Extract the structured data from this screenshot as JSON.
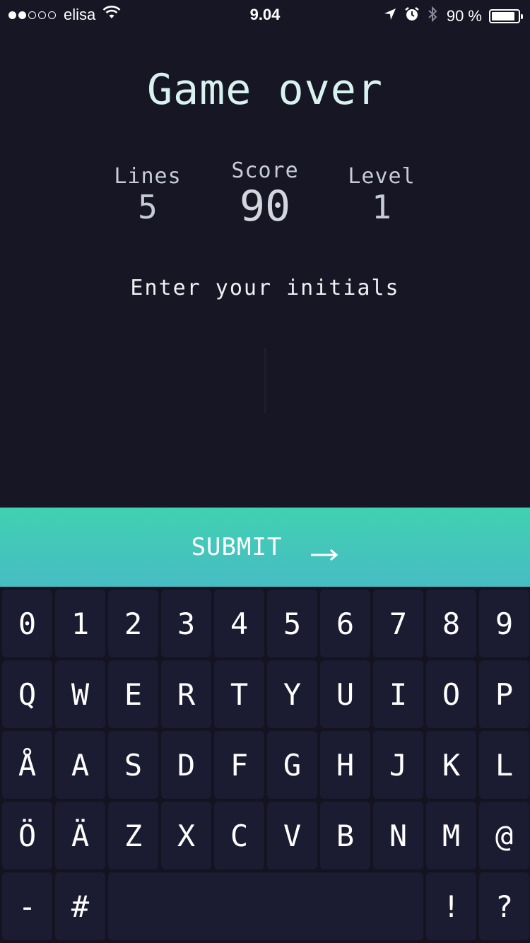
{
  "status_bar": {
    "carrier": "elisa",
    "signal_bars_filled": 2,
    "signal_bars_total": 5,
    "time": "9.04",
    "battery_percent": "90 %",
    "icons": [
      "wifi-icon",
      "location-arrow-icon",
      "alarm-icon",
      "bluetooth-icon",
      "battery-icon"
    ]
  },
  "game_over": {
    "title": "Game over",
    "stats": {
      "lines_label": "Lines",
      "lines_value": "5",
      "score_label": "Score",
      "score_value": "90",
      "level_label": "Level",
      "level_value": "1"
    },
    "prompt": "Enter your initials",
    "initials_value": ""
  },
  "submit": {
    "label": "SUBMIT",
    "icon": "arrow-right-icon",
    "gradient": [
      "#40d1b1",
      "#47bcc4"
    ]
  },
  "keyboard": {
    "rows": [
      [
        "0",
        "1",
        "2",
        "3",
        "4",
        "5",
        "6",
        "7",
        "8",
        "9"
      ],
      [
        "Q",
        "W",
        "E",
        "R",
        "T",
        "Y",
        "U",
        "I",
        "O",
        "P"
      ],
      [
        "Å",
        "A",
        "S",
        "D",
        "F",
        "G",
        "H",
        "J",
        "K",
        "L"
      ],
      [
        "Ö",
        "Ä",
        "Z",
        "X",
        "C",
        "V",
        "B",
        "N",
        "M",
        "@"
      ],
      [
        "-",
        "#",
        " ",
        "!",
        "?"
      ]
    ]
  },
  "colors": {
    "background": "#161624",
    "key_background": "#1b1b31",
    "title": "#d8f3ef"
  }
}
